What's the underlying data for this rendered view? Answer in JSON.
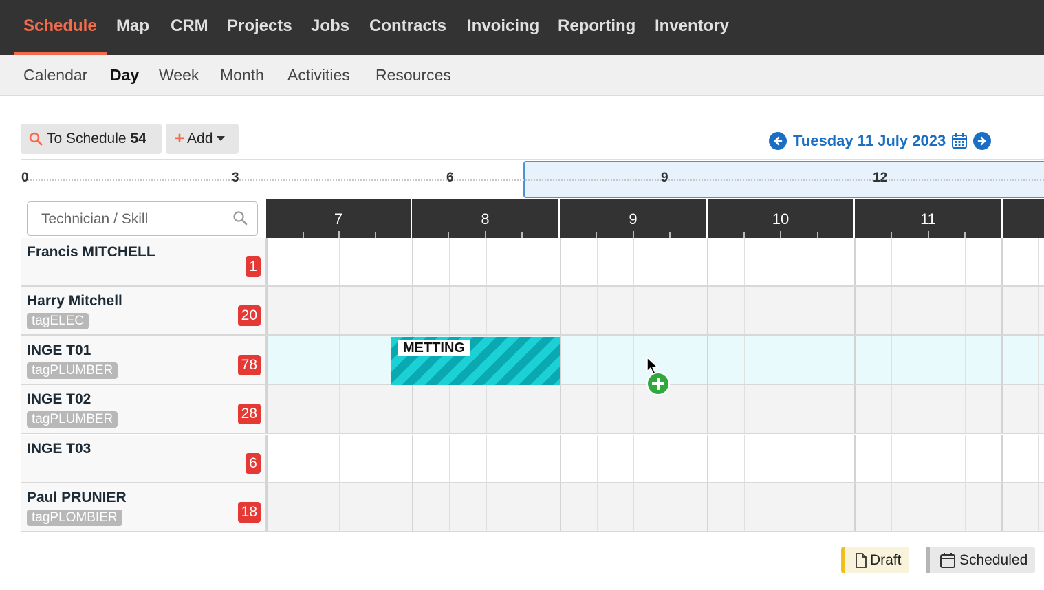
{
  "topnav": {
    "items": [
      "Schedule",
      "Map",
      "CRM",
      "Projects",
      "Jobs",
      "Contracts",
      "Invoicing",
      "Reporting",
      "Inventory"
    ],
    "active": "Schedule"
  },
  "subnav": {
    "items": [
      "Calendar",
      "Day",
      "Week",
      "Month",
      "Activities",
      "Resources"
    ],
    "active": "Day"
  },
  "toolbar": {
    "to_schedule_label": "To Schedule",
    "to_schedule_count": "54",
    "add_label": "Add"
  },
  "date_nav": {
    "date": "Tuesday 11 July 2023"
  },
  "timeline": {
    "ticks": [
      "0",
      "3",
      "6",
      "9",
      "12"
    ]
  },
  "search": {
    "placeholder": "Technician / Skill"
  },
  "hours": [
    "7",
    "8",
    "9",
    "10",
    "11"
  ],
  "technicians": [
    {
      "name": "Francis MITCHELL",
      "tag": "",
      "count": "1"
    },
    {
      "name": "Harry Mitchell",
      "tag": "tagELEC",
      "count": "20"
    },
    {
      "name": "INGE T01",
      "tag": "tagPLUMBER",
      "count": "78"
    },
    {
      "name": "INGE T02",
      "tag": "tagPLUMBER",
      "count": "28"
    },
    {
      "name": "INGE T03",
      "tag": "",
      "count": "6"
    },
    {
      "name": "Paul PRUNIER",
      "tag": "tagPLOMBIER",
      "count": "18"
    }
  ],
  "event": {
    "label": "METTING"
  },
  "legend": {
    "draft_label": "Draft",
    "scheduled_label": "Scheduled"
  },
  "colors": {
    "accent": "#f26b4b",
    "nav_bg": "#333333",
    "link_blue": "#1a6fc4",
    "badge_red": "#e53935",
    "event_cyan": "#1bd1d6",
    "add_green": "#2eaa3c",
    "draft_yellow": "#f0c020"
  }
}
